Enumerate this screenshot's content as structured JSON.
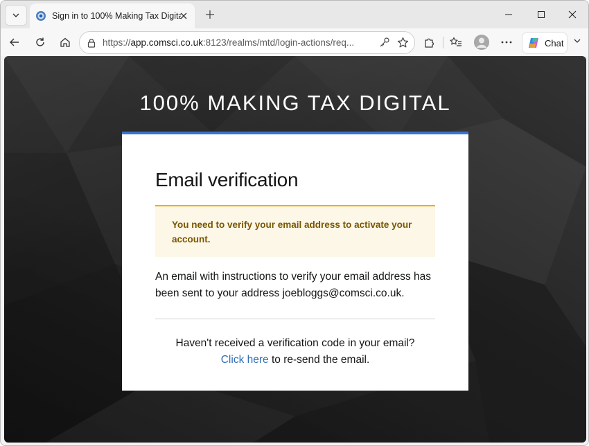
{
  "browser": {
    "tab": {
      "title": "Sign in to 100% Making Tax Digital",
      "favicon": "app-favicon-icon",
      "close": "close-icon"
    },
    "address_bar": {
      "url_prefix": "https://",
      "url_host": "app.comsci.co.uk",
      "url_rest": ":8123/realms/mtd/login-actions/req..."
    },
    "chat_button_label": "Chat",
    "icons": [
      "tab-list-icon",
      "new-tab-icon",
      "minimize-icon",
      "maximize-icon",
      "window-close-icon",
      "back-icon",
      "reload-icon",
      "home-icon",
      "lock-icon",
      "key-icon",
      "favorite-star-icon",
      "extensions-icon",
      "favorites-icon",
      "profile-avatar",
      "more-icon",
      "copilot-icon",
      "chevron-down-icon"
    ]
  },
  "page": {
    "brand_title": "100% MAKING TAX DIGITAL",
    "card": {
      "heading": "Email verification",
      "alert": "You need to verify your email address to activate your account.",
      "body": "An email with instructions to verify your email address has been sent to your address joebloggs@comsci.co.uk.",
      "resend_question": "Haven't received a verification code in your email?",
      "resend_link": "Click here",
      "resend_suffix": " to re-send the email."
    }
  },
  "colors": {
    "accent": "#3b73d0",
    "alert_border": "#f0ab00",
    "alert_bg": "#fdf7e7",
    "alert_text": "#795600",
    "link": "#2f6eb8",
    "page_bg": "#262626"
  }
}
